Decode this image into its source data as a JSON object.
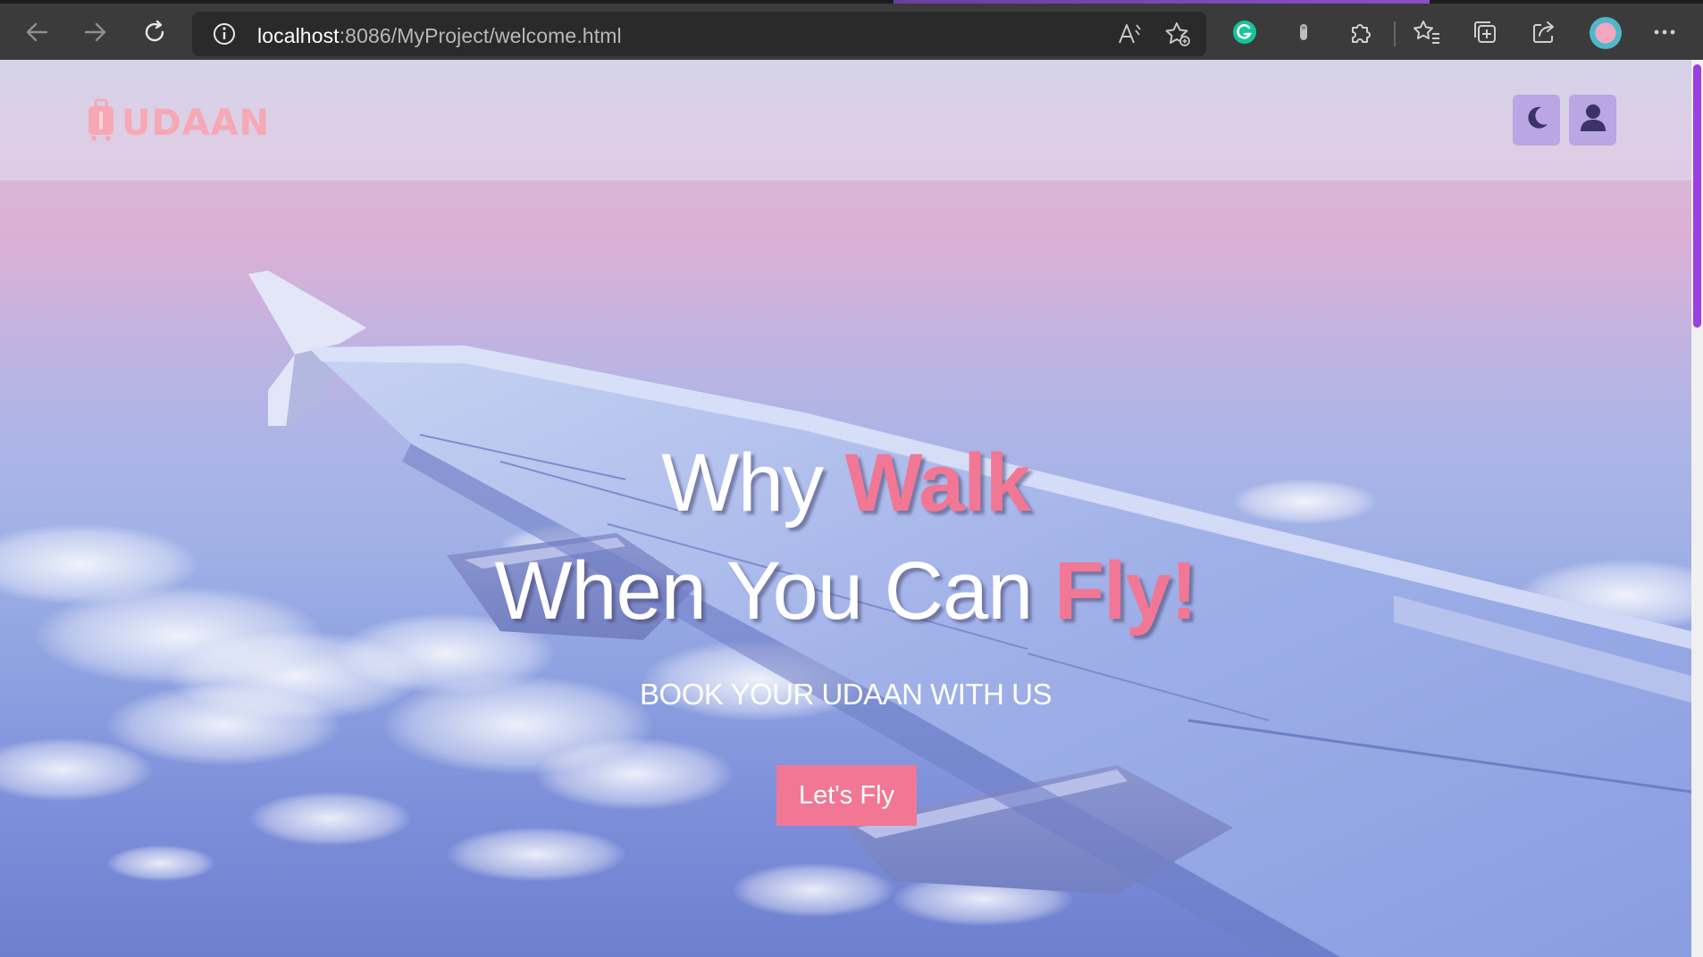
{
  "browser": {
    "url_host": "localhost",
    "url_path": ":8086/MyProject/welcome.html"
  },
  "header": {
    "logo_text": "UDAAN",
    "brand_color": "#f6a8b4",
    "button_color": "#b9a6e2"
  },
  "hero": {
    "line1_white": "Why ",
    "line1_pink": "Walk",
    "line2_white": "When You Can ",
    "line2_pink": "Fly!",
    "tagline": "BOOK YOUR UDAAN WITH US",
    "cta_label": "Let's Fly",
    "accent_color": "#f27795"
  },
  "icons": {
    "back": "back-arrow-icon",
    "forward": "forward-arrow-icon",
    "reload": "reload-icon",
    "info": "info-icon",
    "read_aloud": "read-aloud-icon",
    "favorite_add": "add-favorite-icon",
    "grammarly": "grammarly-icon",
    "extension_pin": "extension-icon",
    "extensions": "puzzle-icon",
    "favorites": "favorites-icon",
    "collections": "collections-icon",
    "share": "share-icon",
    "more": "more-icon",
    "dark_mode": "moon-icon",
    "account": "user-icon",
    "logo": "luggage-icon"
  }
}
